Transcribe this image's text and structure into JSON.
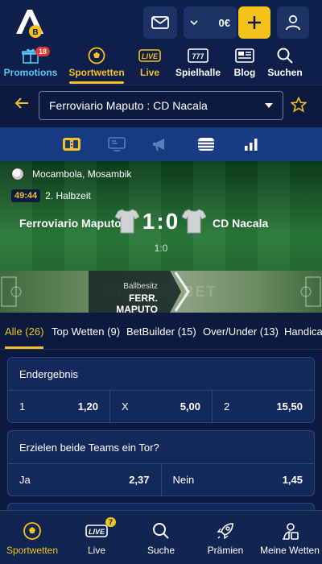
{
  "header": {
    "logo_text": "B",
    "balance": "0€"
  },
  "nav": [
    {
      "label": "Promotions",
      "badge": "18"
    },
    {
      "label": "Sportwetten"
    },
    {
      "label": "Live",
      "icon_text": "LIVE"
    },
    {
      "label": "Spielhalle",
      "icon_text": "777"
    },
    {
      "label": "Blog"
    },
    {
      "label": "Suchen"
    }
  ],
  "match_select": {
    "value": "Ferroviario Maputo : CD Nacala"
  },
  "scoreboard": {
    "location": "Mocambola, Mosambik",
    "clock": "49:44",
    "period": "2. Halbzeit",
    "home": "Ferroviario Maputo",
    "away": "CD Nacala",
    "score": "1:0",
    "halftime": "1:0",
    "possession_label": "Ballbesitz",
    "possession_team": "FERR. MAPUTO",
    "watermark": "ADMIRALBET"
  },
  "market_tabs": [
    {
      "label": "Alle (26)"
    },
    {
      "label": "Top Wetten (9)"
    },
    {
      "label": "BetBuilder (15)"
    },
    {
      "label": "Over/Under (13)"
    },
    {
      "label": "Handica"
    }
  ],
  "markets": [
    {
      "title": "Endergebnis",
      "odds": [
        {
          "label": "1",
          "value": "1,20"
        },
        {
          "label": "X",
          "value": "5,00"
        },
        {
          "label": "2",
          "value": "15,50"
        }
      ]
    },
    {
      "title": "Erzielen beide Teams ein Tor?",
      "odds": [
        {
          "label": "Ja",
          "value": "2,37"
        },
        {
          "label": "Nein",
          "value": "1,45"
        }
      ]
    }
  ],
  "bottom_nav": [
    {
      "label": "Sportwetten"
    },
    {
      "label": "Live",
      "badge": "7",
      "icon_text": "LIVE"
    },
    {
      "label": "Suche"
    },
    {
      "label": "Prämien"
    },
    {
      "label": "Meine Wetten"
    }
  ],
  "colors": {
    "accent": "#f4c21a",
    "navy": "#0b1a3e",
    "tabbar": "#173a82",
    "promo": "#58c8ff"
  }
}
